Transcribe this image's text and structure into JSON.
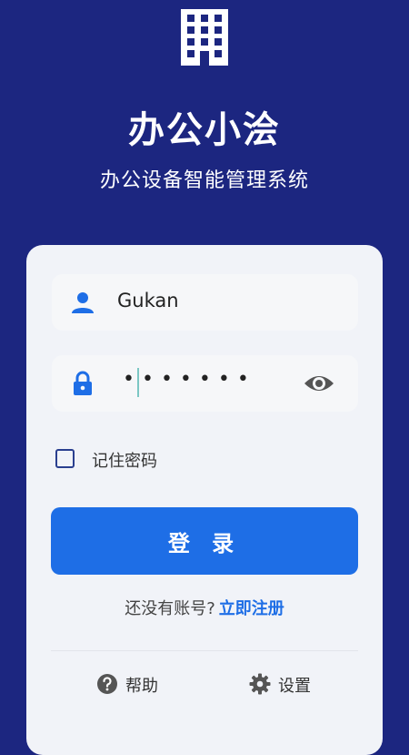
{
  "header": {
    "title": "办公小浍",
    "subtitle": "办公设备智能管理系统"
  },
  "login_form": {
    "username_value": "Gukan",
    "password_masked": "•••••••",
    "remember_label": "记住密码",
    "remember_checked": false,
    "login_button_label": "登 录",
    "register_prompt": "还没有账号?",
    "register_link": "立即注册"
  },
  "footer": {
    "help_label": "帮助",
    "settings_label": "设置"
  },
  "colors": {
    "background": "#1c2680",
    "accent": "#1e6ee6",
    "card": "#f1f3f8"
  },
  "icons": [
    "building-icon",
    "user-icon",
    "lock-icon",
    "eye-icon",
    "help-icon",
    "gear-icon"
  ]
}
